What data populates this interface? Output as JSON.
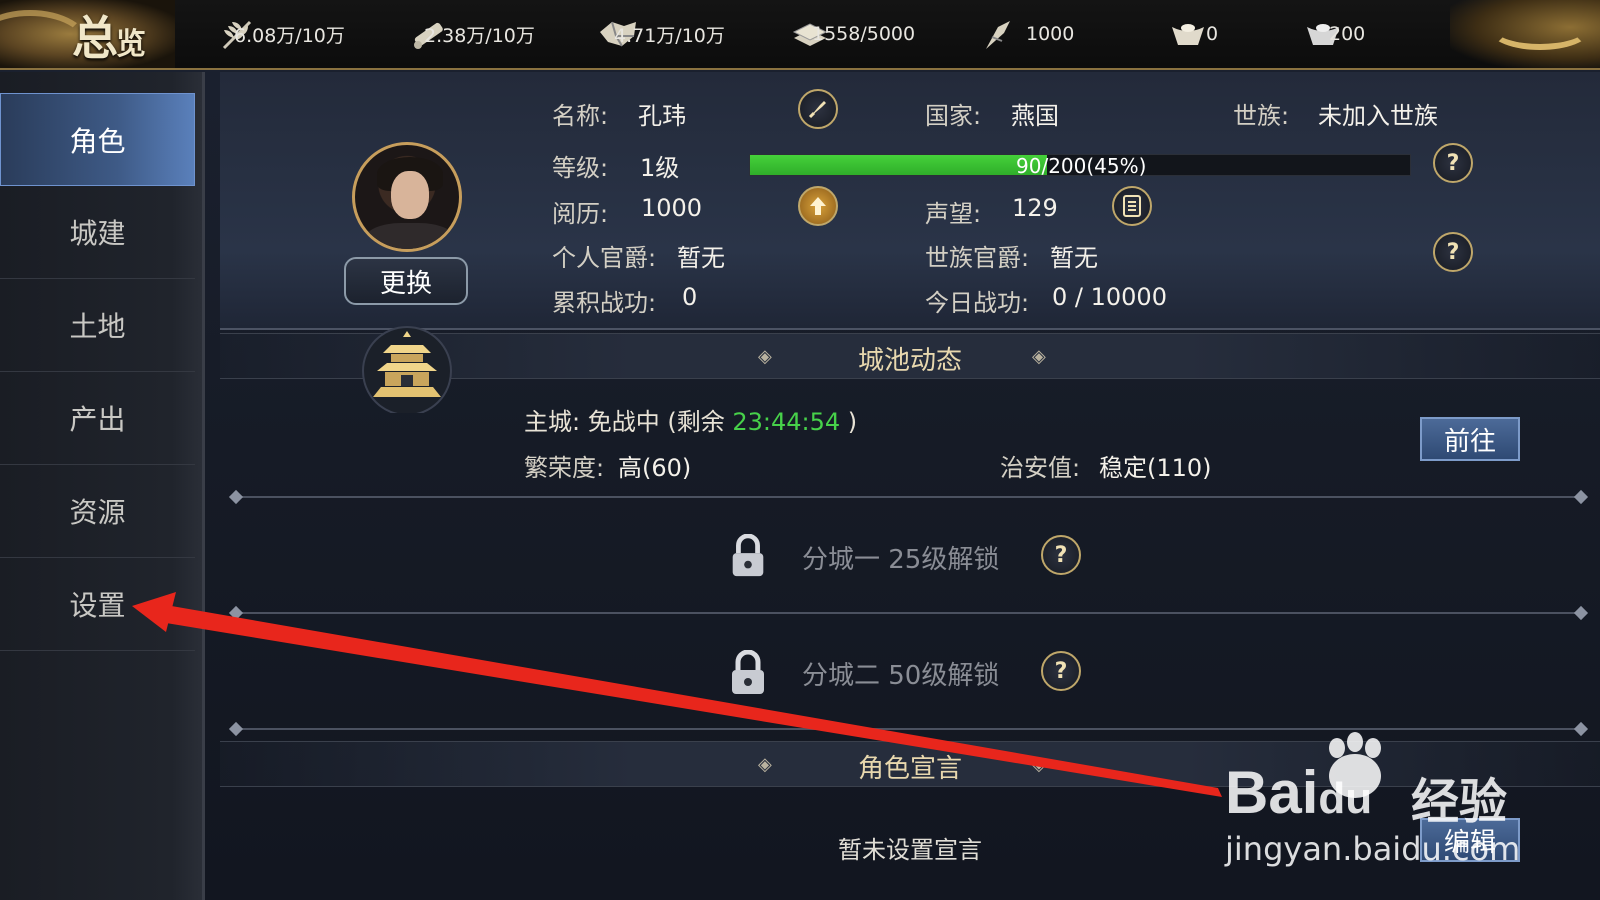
{
  "header": {
    "title_big": "总",
    "title_small": "览",
    "resources": [
      {
        "icon": "grain-icon",
        "value": "6.08万/10万"
      },
      {
        "icon": "wood-icon",
        "value": "2.38万/10万"
      },
      {
        "icon": "stone-icon",
        "value": "4.71万/10万"
      },
      {
        "icon": "iron-icon",
        "value": "1558/5000"
      },
      {
        "icon": "decree-icon",
        "value": "1000"
      },
      {
        "icon": "gold-ingot-icon",
        "value": "0"
      },
      {
        "icon": "silver-ingot-icon",
        "value": "200"
      }
    ]
  },
  "sidebar": {
    "items": [
      {
        "label": "角色",
        "active": true
      },
      {
        "label": "城建",
        "active": false
      },
      {
        "label": "土地",
        "active": false
      },
      {
        "label": "产出",
        "active": false
      },
      {
        "label": "资源",
        "active": false
      },
      {
        "label": "设置",
        "active": false
      }
    ]
  },
  "profile": {
    "change_label": "更换",
    "name_label": "名称:",
    "name_value": "孔玮",
    "country_label": "国家:",
    "country_value": "燕国",
    "clan_label": "世族:",
    "clan_value": "未加入世族",
    "level_label": "等级:",
    "level_value": "1级",
    "exp_text": "90/200(45%)",
    "exp_fraction": 0.45,
    "experience_label": "阅历:",
    "experience_value": "1000",
    "prestige_label": "声望:",
    "prestige_value": "129",
    "personal_rank_label": "个人官爵:",
    "personal_rank_value": "暂无",
    "clan_rank_label": "世族官爵:",
    "clan_rank_value": "暂无",
    "total_merit_label": "累积战功:",
    "total_merit_value": "0",
    "today_merit_label": "今日战功:",
    "today_merit_value": "0 / 10000"
  },
  "city": {
    "section_title": "城池动态",
    "main_city_prefix": "主城: 免战中 (剩余 ",
    "main_city_timer": "23:44:54",
    "main_city_suffix": " )",
    "prosperity_label": "繁荣度:",
    "prosperity_value": "高(60)",
    "security_label": "治安值:",
    "security_value": "稳定(110)",
    "goto_label": "前往",
    "branch1": "分城一 25级解锁",
    "branch2": "分城二 50级解锁"
  },
  "declaration": {
    "section_title": "角色宣言",
    "text": "暂未设置宣言",
    "edit_label": "编辑"
  },
  "watermark": {
    "brand_left": "Bai",
    "brand_mid": "du",
    "brand_right": "经验",
    "url": "jingyan.baidu.com"
  },
  "colors": {
    "accent_blue": "#3e5a86",
    "progress_green": "#45d13a",
    "timer_green": "#47d14a",
    "gold": "#c79e5c",
    "arrow_red": "#e8261c"
  }
}
